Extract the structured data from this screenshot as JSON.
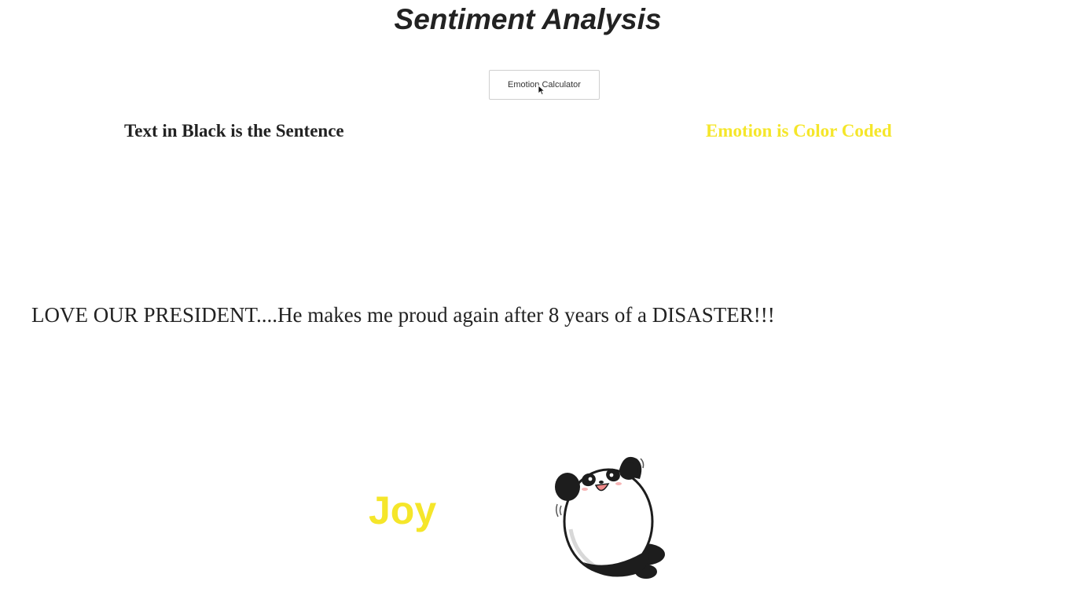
{
  "header": {
    "title": "Sentiment Analysis"
  },
  "toolbar": {
    "calculator_button_label": "Emotion Calculator"
  },
  "legend": {
    "sentence_note": "Text in Black is the Sentence",
    "emotion_note": "Emotion is Color Coded",
    "emotion_note_color": "#f5e62a"
  },
  "result": {
    "sentence": "LOVE OUR PRESIDENT....He makes me proud again after 8 years of a DISASTER!!!",
    "emotion": "Joy",
    "emotion_color": "#f5e62a",
    "illustration": "panda-waving-icon"
  }
}
